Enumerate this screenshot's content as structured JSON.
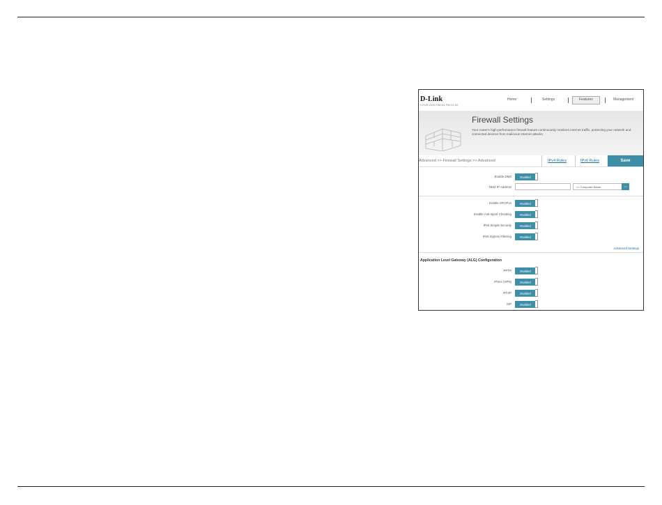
{
  "app": {
    "logo": "D-Link",
    "model": "COVR-2200 HW:A1 FW:V1.00"
  },
  "nav": {
    "home": "Home",
    "settings": "Settings",
    "features": "Features",
    "management": "Management"
  },
  "banner": {
    "title": "Firewall Settings",
    "description": "Your router's high-performance firewall feature continuously monitors Internet traffic, protecting your network and connected devices from malicious Internet attacks."
  },
  "breadcrumb": "Advanced >> Firewall Settings >> Advanced",
  "tabs": {
    "ipv4": "IPv4 Rules",
    "ipv6": "IPv6 Rules",
    "save": "Save"
  },
  "dmz": {
    "enable_label": "Enable DMZ",
    "enable_value": "Enabled",
    "ip_label": "DMZ IP Address",
    "ip_value": "",
    "computer_select": "<< Computer Name"
  },
  "security": [
    {
      "label": "Enable SPI IPv4",
      "value": "Enabled"
    },
    {
      "label": "Enable Anti-spoof Checking",
      "value": "Enabled"
    },
    {
      "label": "IPv6 Simple Security",
      "value": "Enabled"
    },
    {
      "label": "IPv6 Ingress Filtering",
      "value": "Enabled"
    }
  ],
  "advanced_link": "Advanced Settings",
  "alg": {
    "title": "Application Level Gateway (ALG) Configuration",
    "items": [
      {
        "label": "PPTP",
        "value": "Enabled"
      },
      {
        "label": "IPSec (VPN)",
        "value": "Enabled"
      },
      {
        "label": "RTSP",
        "value": "Enabled"
      },
      {
        "label": "SIP",
        "value": "Enabled"
      }
    ]
  },
  "colors": {
    "accent": "#3c8fa6",
    "link": "#1b6fb1"
  }
}
